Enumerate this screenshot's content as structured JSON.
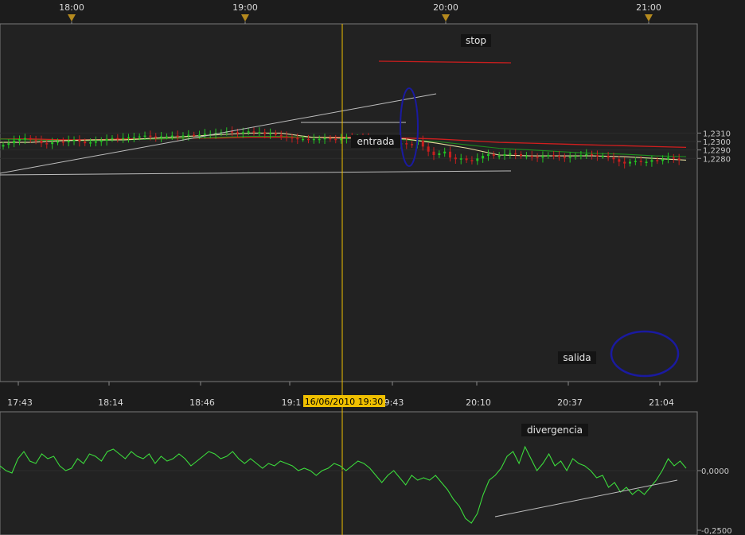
{
  "colors": {
    "background": "#1c1c1c",
    "plot_bg": "#222222",
    "bull": "#22c322",
    "bear": "#c81e1e",
    "ma_fast": "#e8e0a0",
    "ma_mid": "#1e8c1e",
    "ma_slow": "#d21e1e",
    "cursor": "#f0c000",
    "oscillator": "#3cdc3c",
    "ellipse": "#1a1aa0",
    "trendline": "#bdbdbd"
  },
  "chart_data": [
    {
      "type": "candlestick",
      "title": "",
      "top_time_markers": [
        "18:00",
        "19:00",
        "20:00",
        "21:00"
      ],
      "x_tick_labels": [
        "17:43",
        "18:14",
        "18:46",
        "19:1",
        "9:43",
        "20:10",
        "20:37",
        "21:04"
      ],
      "y_tick_labels": [
        "1,2310",
        "1,2300",
        "1,2290",
        "1,2280"
      ],
      "ylim": [
        1.2272,
        1.2314
      ],
      "cursor_label": "16/06/2010 19:30",
      "annotations": [
        "stop",
        "entrada",
        "salida"
      ],
      "series": [
        {
          "name": "",
          "kind": "candles_close",
          "values": [
            1.2296,
            1.2298,
            1.2301,
            1.2303,
            1.2304,
            1.2302,
            1.2301,
            1.2298,
            1.2297,
            1.2299,
            1.23,
            1.2299,
            1.2301,
            1.2302,
            1.23,
            1.2298,
            1.2299,
            1.23,
            1.2301,
            1.2303,
            1.2304,
            1.2303,
            1.2304,
            1.2305,
            1.2305,
            1.2306,
            1.2307,
            1.2306,
            1.2305,
            1.2306,
            1.2306,
            1.2307,
            1.2306,
            1.2307,
            1.2308,
            1.2307,
            1.2308,
            1.2309,
            1.2309,
            1.231,
            1.2311,
            1.2312,
            1.2311,
            1.231,
            1.2311,
            1.2312,
            1.2311,
            1.2311,
            1.2309,
            1.231,
            1.2308,
            1.2306,
            1.2305,
            1.2304,
            1.2303,
            1.2303,
            1.2302,
            1.2303,
            1.2303,
            1.2304,
            1.2303,
            1.2302,
            1.2303,
            1.2305,
            1.2304,
            1.2305,
            1.2304,
            1.23,
            1.2298,
            1.2302,
            1.2299,
            1.2297,
            1.2297,
            1.2298,
            1.2297,
            1.2296,
            1.2301,
            1.2294,
            1.2288,
            1.2284,
            1.2286,
            1.2288,
            1.2281,
            1.2279,
            1.228,
            1.2278,
            1.2277,
            1.228,
            1.2283,
            1.2285,
            1.2283,
            1.2283,
            1.2285,
            1.2286,
            1.2285,
            1.2283,
            1.2283,
            1.2282,
            1.2281,
            1.2283,
            1.2284,
            1.2283,
            1.2282,
            1.2281,
            1.2282,
            1.2283,
            1.2284,
            1.2285,
            1.2284,
            1.2283,
            1.2283,
            1.2281,
            1.2279,
            1.2276,
            1.2274,
            1.2276,
            1.2277,
            1.2276,
            1.2276,
            1.2278,
            1.2277,
            1.2279,
            1.2281,
            1.228,
            1.2278
          ]
        },
        {
          "name": "",
          "kind": "ma_fast",
          "values": [
            1.2299,
            1.2299,
            1.2301,
            1.2302,
            1.2302,
            1.2304,
            1.2306,
            1.2308,
            1.231,
            1.231,
            1.2305,
            1.2304,
            1.2304,
            1.2303,
            1.2298,
            1.2292,
            1.2284,
            1.2283,
            1.2283,
            1.2283,
            1.2282,
            1.228,
            1.2278
          ]
        },
        {
          "name": "",
          "kind": "ma_mid",
          "values": [
            1.2303,
            1.2302,
            1.2301,
            1.2301,
            1.2302,
            1.2303,
            1.2304,
            1.2305,
            1.2306,
            1.2306,
            1.2305,
            1.2304,
            1.2304,
            1.2302,
            1.23,
            1.2296,
            1.2292,
            1.229,
            1.2288,
            1.2286,
            1.2285,
            1.2283,
            1.2282
          ]
        },
        {
          "name": "",
          "kind": "ma_slow",
          "values": [
            1.2303,
            1.2303,
            1.2302,
            1.2302,
            1.2303,
            1.2303,
            1.2304,
            1.2304,
            1.2305,
            1.2305,
            1.2305,
            1.2305,
            1.2305,
            1.2304,
            1.2303,
            1.2301,
            1.2299,
            1.2298,
            1.2297,
            1.2296,
            1.2295,
            1.2294,
            1.2293
          ]
        }
      ]
    },
    {
      "type": "line",
      "title": "",
      "y_tick_labels": [
        "0,0000",
        "-0,2500"
      ],
      "ylim": [
        -0.26,
        0.17
      ],
      "annotations": [
        "divergencia"
      ],
      "series": [
        {
          "name": "",
          "values": [
            0.02,
            0.0,
            -0.01,
            0.05,
            0.08,
            0.04,
            0.03,
            0.07,
            0.05,
            0.06,
            0.02,
            0.0,
            0.01,
            0.05,
            0.03,
            0.07,
            0.06,
            0.04,
            0.08,
            0.09,
            0.07,
            0.05,
            0.08,
            0.06,
            0.05,
            0.07,
            0.03,
            0.06,
            0.04,
            0.05,
            0.07,
            0.05,
            0.02,
            0.04,
            0.06,
            0.08,
            0.07,
            0.05,
            0.06,
            0.08,
            0.05,
            0.03,
            0.05,
            0.03,
            0.01,
            0.03,
            0.02,
            0.04,
            0.03,
            0.02,
            0.0,
            0.01,
            0.0,
            -0.02,
            0.0,
            0.01,
            0.03,
            0.02,
            0.0,
            0.02,
            0.04,
            0.03,
            0.01,
            -0.02,
            -0.05,
            -0.02,
            0.0,
            -0.03,
            -0.06,
            -0.02,
            -0.04,
            -0.03,
            -0.04,
            -0.02,
            -0.05,
            -0.08,
            -0.12,
            -0.15,
            -0.2,
            -0.22,
            -0.18,
            -0.1,
            -0.04,
            -0.02,
            0.01,
            0.06,
            0.08,
            0.03,
            0.1,
            0.05,
            0.0,
            0.03,
            0.07,
            0.02,
            0.04,
            0.0,
            0.05,
            0.03,
            0.02,
            0.0,
            -0.03,
            -0.02,
            -0.07,
            -0.05,
            -0.09,
            -0.07,
            -0.1,
            -0.08,
            -0.1,
            -0.07,
            -0.04,
            0.0,
            0.05,
            0.02,
            0.04,
            0.01
          ]
        }
      ]
    }
  ]
}
